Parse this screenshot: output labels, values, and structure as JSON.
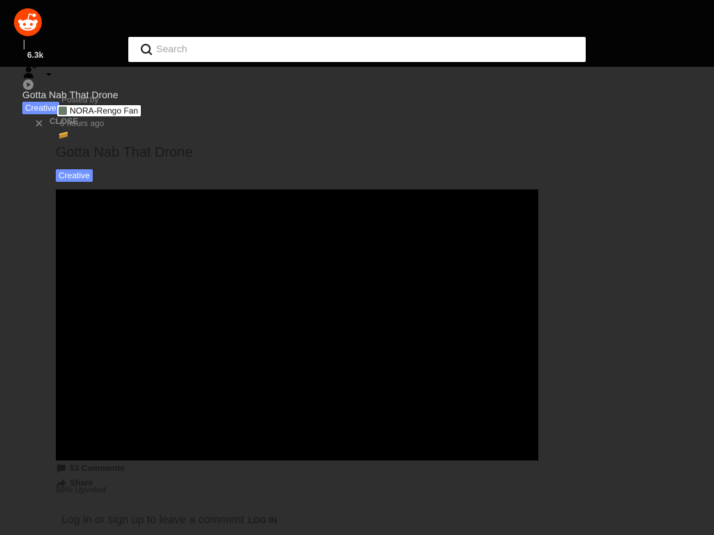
{
  "header": {
    "score": "6.3k",
    "search": {
      "placeholder": "Search",
      "value": ""
    }
  },
  "mini_bar": {
    "title": "Gotta Nab That Drone",
    "flair": "Creative",
    "close_label": "CLOSE"
  },
  "post": {
    "posted_by_label": "Posted by",
    "author": "NORA-Rengo Fan",
    "time": "6 hours ago",
    "title": "Gotta Nab That Drone",
    "flair": "Creative",
    "comments_label": "53 Comments",
    "share_label": "Share",
    "upvoted_label": "99% Upvoted"
  },
  "comment_box": {
    "prompt": "Log in or sign up to leave a comment",
    "login_label": "LOG IN"
  },
  "colors": {
    "brand": "#ff4500",
    "flair": "#7193ff",
    "topbar": "#030303",
    "page_bg": "#2f2f2f"
  },
  "icons": [
    "reddit-logo",
    "search-icon",
    "user-icon",
    "chevron-down-icon",
    "play-icon",
    "close-icon",
    "award-icon",
    "comment-icon",
    "share-icon"
  ]
}
